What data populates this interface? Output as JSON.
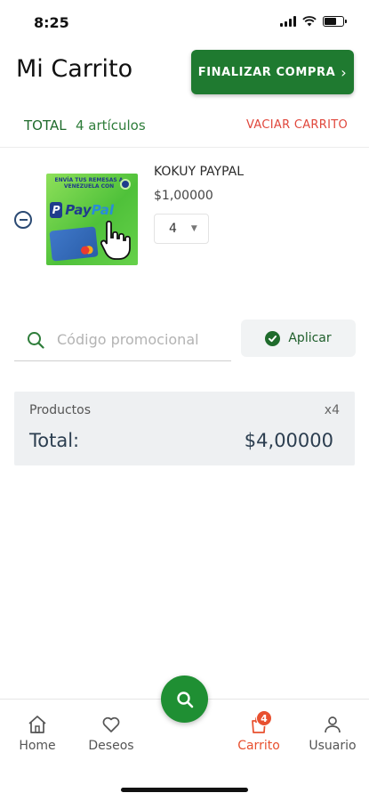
{
  "status_bar": {
    "time": "8:25"
  },
  "header": {
    "title": "Mi Carrito",
    "checkout_label": "FINALIZAR COMPRA"
  },
  "summary": {
    "total_label": "TOTAL",
    "item_count_label": "4 artículos",
    "clear_cart_label": "VACIAR CARRITO"
  },
  "cart": {
    "items": [
      {
        "name": "KOKUY PAYPAL",
        "price": "$1,00000",
        "quantity": "4",
        "image_text": {
          "caption": "ENVÍA TUS REMESAS A VENEZUELA CON",
          "brand": "PayPal"
        }
      }
    ]
  },
  "promo": {
    "placeholder": "Código promocional",
    "apply_label": "Aplicar"
  },
  "totals": {
    "products_label": "Productos",
    "products_count": "x4",
    "total_label": "Total:",
    "total_value": "$4,00000"
  },
  "nav": {
    "home_label": "Home",
    "wishlist_label": "Deseos",
    "cart_label": "Carrito",
    "cart_badge": "4",
    "user_label": "Usuario"
  },
  "colors": {
    "primary_green": "#1f7a30",
    "accent_orange": "#e8502f",
    "danger_red": "#e0463b"
  }
}
